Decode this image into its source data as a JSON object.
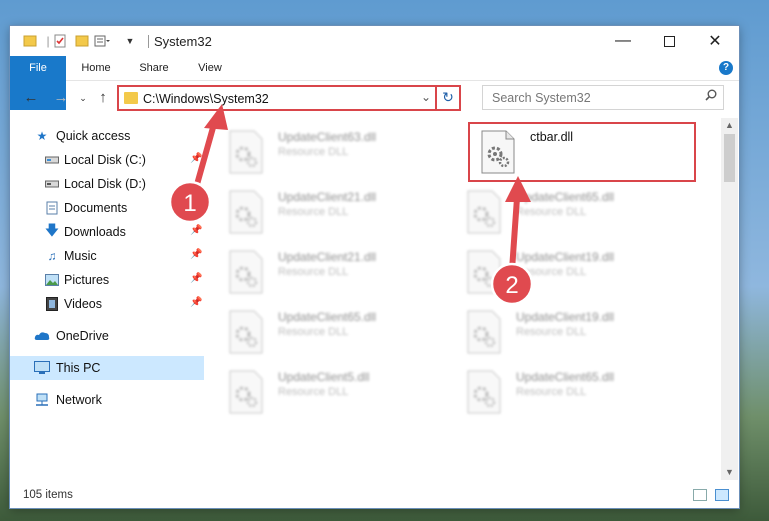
{
  "window": {
    "title": "System32"
  },
  "ribbon": {
    "tabs": [
      "File",
      "Home",
      "Share",
      "View"
    ],
    "help": "?"
  },
  "address": {
    "path": "C:\\Windows\\System32"
  },
  "search": {
    "placeholder": "Search System32"
  },
  "nav": {
    "items": [
      {
        "label": "Quick access",
        "icon": "star-icon",
        "pinned": false
      },
      {
        "label": "Local Disk (C:)",
        "icon": "drive-icon",
        "pinned": true
      },
      {
        "label": "Local Disk (D:)",
        "icon": "drive-icon",
        "pinned": false
      },
      {
        "label": "Documents",
        "icon": "documents-icon",
        "pinned": true
      },
      {
        "label": "Downloads",
        "icon": "download-icon",
        "pinned": true
      },
      {
        "label": "Music",
        "icon": "music-icon",
        "pinned": true
      },
      {
        "label": "Pictures",
        "icon": "pictures-icon",
        "pinned": true
      },
      {
        "label": "Videos",
        "icon": "videos-icon",
        "pinned": true
      },
      {
        "label": "OneDrive",
        "icon": "onedrive-icon",
        "pinned": false
      },
      {
        "label": "This PC",
        "icon": "computer-icon",
        "pinned": false,
        "selected": true
      },
      {
        "label": "Network",
        "icon": "network-icon",
        "pinned": false
      }
    ]
  },
  "files": {
    "left": [
      {
        "name": "UpdateClient63.dll",
        "type": "Resource DLL"
      },
      {
        "name": "UpdateClient21.dll",
        "type": "Resource DLL"
      },
      {
        "name": "UpdateClient21.dll",
        "type": "Resource DLL"
      },
      {
        "name": "UpdateClient65.dll",
        "type": "Resource DLL"
      },
      {
        "name": "UpdateClient5.dll",
        "type": "Resource DLL"
      }
    ],
    "right": [
      {
        "name": "ctbar.dll",
        "type": "",
        "highlighted": true
      },
      {
        "name": "UpdateClient65.dll",
        "type": "Resource DLL"
      },
      {
        "name": "UpdateClient19.dll",
        "type": "Resource DLL"
      },
      {
        "name": "UpdateClient19.dll",
        "type": "Resource DLL"
      },
      {
        "name": "UpdateClient65.dll",
        "type": "Resource DLL"
      }
    ]
  },
  "status": {
    "count": "105 items"
  },
  "annotations": {
    "step1": "1",
    "step2": "2",
    "color": "#e04a4f"
  }
}
